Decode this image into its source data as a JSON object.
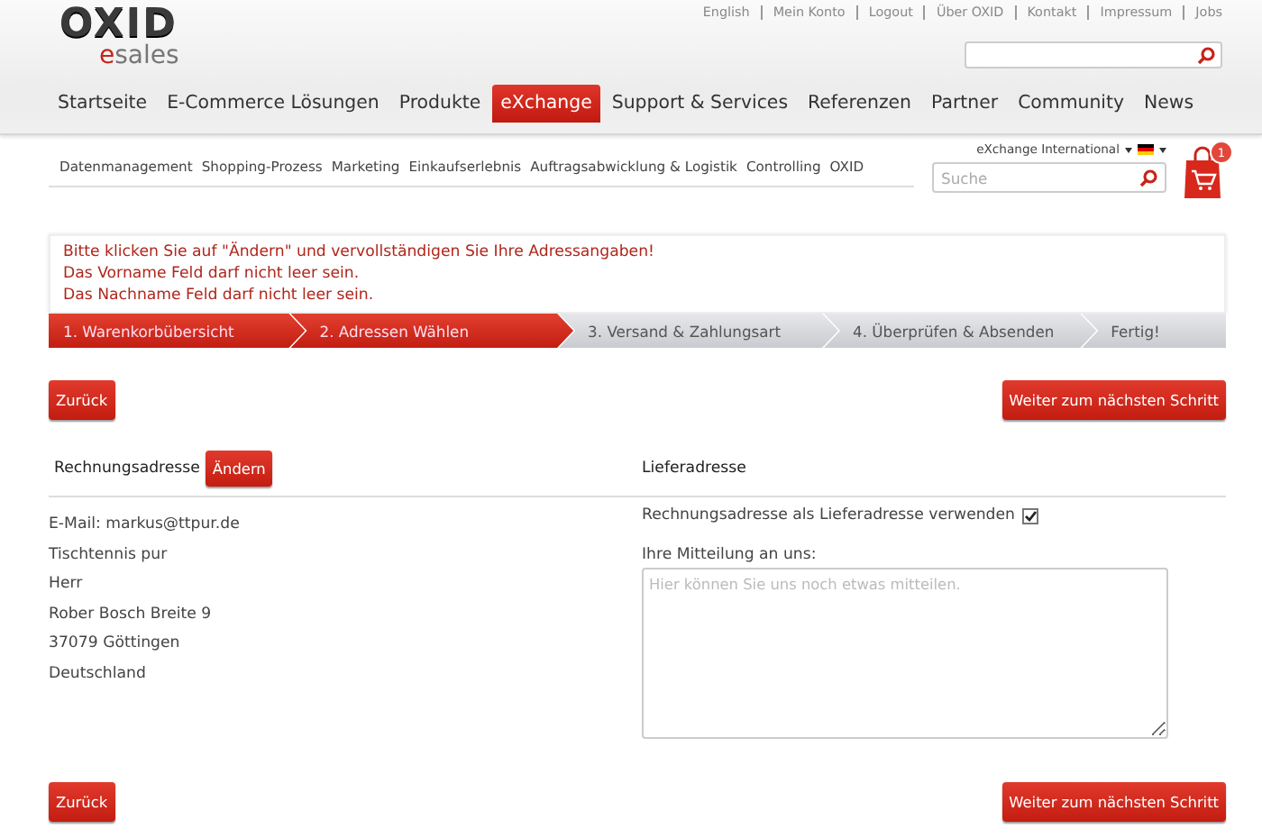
{
  "top_links": [
    "English",
    "Mein Konto",
    "Logout",
    "Über OXID",
    "Kontakt",
    "Impressum",
    "Jobs"
  ],
  "logo": {
    "title": "OXID",
    "subtitle": "esales"
  },
  "main_nav": [
    {
      "label": "Startseite",
      "selected": false
    },
    {
      "label": "E-Commerce Lösungen",
      "selected": false
    },
    {
      "label": "Produkte",
      "selected": false
    },
    {
      "label": "eXchange",
      "selected": true
    },
    {
      "label": "Support & Services",
      "selected": false
    },
    {
      "label": "Referenzen",
      "selected": false
    },
    {
      "label": "Partner",
      "selected": false
    },
    {
      "label": "Community",
      "selected": false
    },
    {
      "label": "News",
      "selected": false
    }
  ],
  "sub_nav": [
    "Datenmanagement",
    "Shopping-Prozess",
    "Marketing",
    "Einkaufserlebnis",
    "Auftragsabwicklung & Logistik",
    "Controlling",
    "OXID"
  ],
  "region_selector": {
    "label": "eXchange International"
  },
  "search": {
    "placeholder": "Suche"
  },
  "cart": {
    "count": "1"
  },
  "messages": [
    "Bitte klicken Sie auf \"Ändern\" und vervollständigen Sie Ihre Adressangaben!",
    "Das Vorname Feld darf nicht leer sein.",
    "Das Nachname Feld darf nicht leer sein."
  ],
  "steps": [
    {
      "label": "1. Warenkorbübersicht",
      "reached": true
    },
    {
      "label": "2. Adressen Wählen",
      "reached": true
    },
    {
      "label": "3. Versand & Zahlungsart",
      "reached": false
    },
    {
      "label": "4. Überprüfen & Absenden",
      "reached": false
    },
    {
      "label": "Fertig!",
      "reached": false
    }
  ],
  "top_buttons": {
    "back": "Zurück",
    "next": "Weiter zum nächsten Schritt"
  },
  "billing": {
    "heading": "Rechnungsadresse",
    "edit_button": "Ändern",
    "lines": [
      "E-Mail: markus@ttpur.de",
      "Tischtennis pur",
      "Herr",
      "Rober Bosch Breite 9",
      "37079 Göttingen",
      "Deutschland"
    ]
  },
  "shipping": {
    "heading": "Lieferadresse",
    "same_address": {
      "label": "Rechnungsadresse als Lieferadresse verwenden",
      "checked": true
    },
    "message_label": "Ihre Mitteilung an uns:",
    "message": {
      "placeholder": "Hier können Sie uns noch etwas mitteilen."
    }
  },
  "bottom_buttons": {
    "back": "Zurück",
    "next": "Weiter zum nächsten Schritt"
  }
}
